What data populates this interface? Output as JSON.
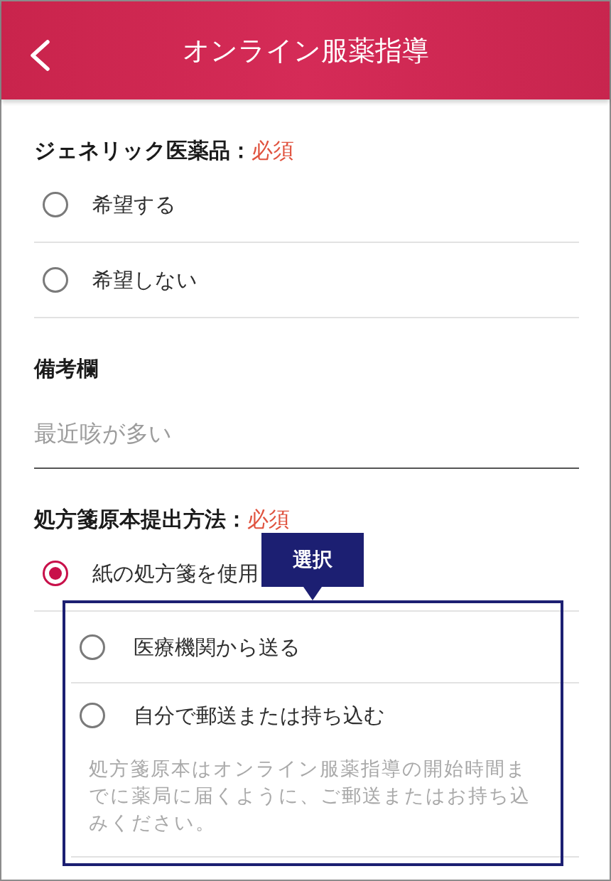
{
  "header": {
    "title": "オンライン服薬指導"
  },
  "sections": [
    {
      "kind": "radio_group",
      "label": "ジェネリック医薬品：",
      "required": "必須",
      "options": [
        {
          "label": "希望する",
          "selected": false
        },
        {
          "label": "希望しない",
          "selected": false
        }
      ]
    },
    {
      "kind": "text_field",
      "label": "備考欄",
      "placeholder": "最近咳が多い"
    },
    {
      "kind": "radio_group",
      "label": "処方箋原本提出方法：",
      "required": "必須",
      "options": [
        {
          "label": "紙の処方箋を使用",
          "selected": true,
          "children": [
            {
              "label": "医療機関から送る",
              "selected": false
            },
            {
              "label": "自分で郵送または持ち込む",
              "selected": false,
              "note": "処方箋原本はオンライン服薬指導の開始時間までに薬局に届くように、ご郵送またはお持ち込みください。"
            }
          ]
        }
      ]
    }
  ],
  "callout": {
    "label": "選択"
  }
}
